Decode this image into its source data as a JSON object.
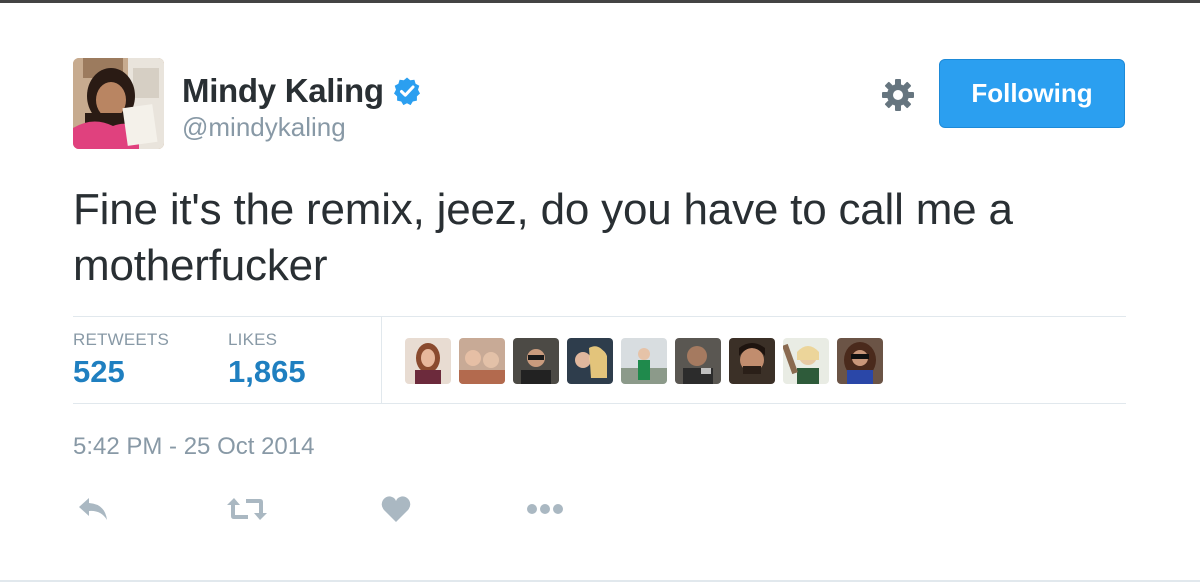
{
  "author": {
    "display_name": "Mindy Kaling",
    "handle": "@mindykaling",
    "verified_icon": "verified-badge-icon",
    "avatar_icon": "avatar"
  },
  "follow_button": {
    "label": "Following",
    "color": "#2b9ff0"
  },
  "settings_icon": "gear-icon",
  "tweet": {
    "text": "Fine it's the remix, jeez, do you have to call me a motherfucker"
  },
  "stats": {
    "retweets_label": "RETWEETS",
    "retweets_value": "525",
    "likes_label": "LIKES",
    "likes_value": "1,865",
    "liker_avatar_count": 9
  },
  "timestamp": "5:42 PM - 25 Oct 2014",
  "actions": [
    {
      "name": "reply",
      "icon": "reply-icon"
    },
    {
      "name": "retweet",
      "icon": "retweet-icon"
    },
    {
      "name": "like",
      "icon": "heart-icon"
    },
    {
      "name": "more",
      "icon": "more-icon"
    }
  ],
  "colors": {
    "text_primary": "#292f33",
    "text_secondary": "#8899a6",
    "stat_value": "#1f7fc0",
    "verified": "#2b9ff0",
    "action_icon": "#aab8c2"
  }
}
